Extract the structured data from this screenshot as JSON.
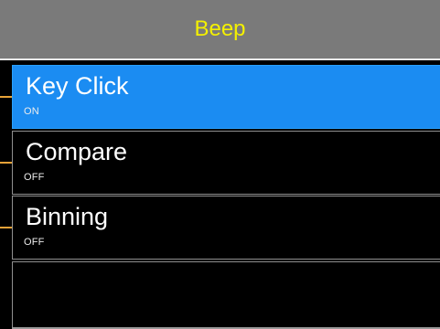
{
  "header": {
    "title": "Beep",
    "title_color": "#f4f000"
  },
  "menu": {
    "items": [
      {
        "label": "Key Click",
        "value": "ON",
        "selected": true
      },
      {
        "label": "Compare",
        "value": "OFF",
        "selected": false
      },
      {
        "label": "Binning",
        "value": "OFF",
        "selected": false
      }
    ],
    "selected_bg_color": "#1b8cf2",
    "connector_color": "#e7a238"
  }
}
